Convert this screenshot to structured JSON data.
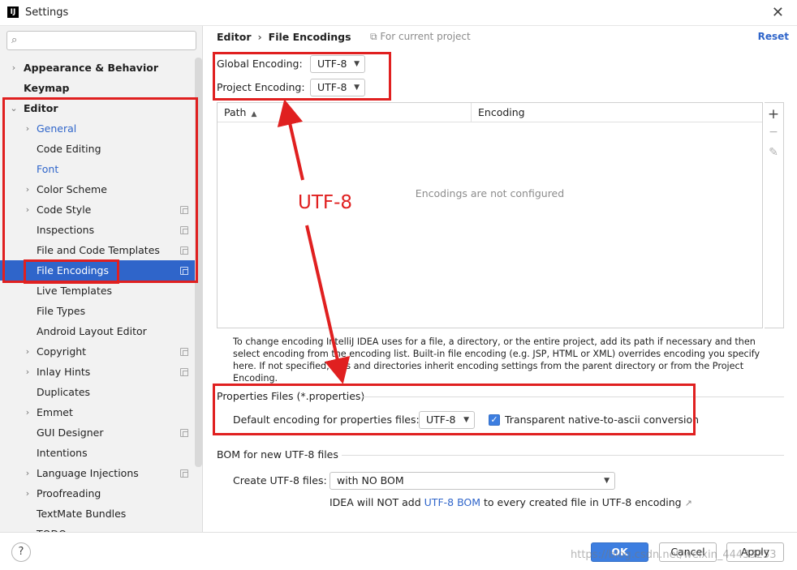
{
  "window": {
    "title": "Settings",
    "app_icon": "IJ"
  },
  "search": {
    "placeholder": ""
  },
  "sidebar": {
    "items": [
      {
        "label": "Appearance & Behavior",
        "level": 0,
        "arrow": "›",
        "marker": false
      },
      {
        "label": "Keymap",
        "level": 0,
        "arrow": "",
        "marker": false
      },
      {
        "label": "Editor",
        "level": 0,
        "arrow": "⌄",
        "marker": false
      },
      {
        "label": "General",
        "level": 1,
        "arrow": "›",
        "marker": false,
        "blue": true
      },
      {
        "label": "Code Editing",
        "level": 1,
        "arrow": "",
        "marker": false
      },
      {
        "label": "Font",
        "level": 1,
        "arrow": "",
        "marker": false,
        "blue": true
      },
      {
        "label": "Color Scheme",
        "level": 1,
        "arrow": "›",
        "marker": false
      },
      {
        "label": "Code Style",
        "level": 1,
        "arrow": "›",
        "marker": true
      },
      {
        "label": "Inspections",
        "level": 1,
        "arrow": "",
        "marker": true
      },
      {
        "label": "File and Code Templates",
        "level": 1,
        "arrow": "",
        "marker": true
      },
      {
        "label": "File Encodings",
        "level": 1,
        "arrow": "",
        "marker": true,
        "selected": true
      },
      {
        "label": "Live Templates",
        "level": 1,
        "arrow": "",
        "marker": false
      },
      {
        "label": "File Types",
        "level": 1,
        "arrow": "",
        "marker": false
      },
      {
        "label": "Android Layout Editor",
        "level": 1,
        "arrow": "",
        "marker": false
      },
      {
        "label": "Copyright",
        "level": 1,
        "arrow": "›",
        "marker": true
      },
      {
        "label": "Inlay Hints",
        "level": 1,
        "arrow": "›",
        "marker": true
      },
      {
        "label": "Duplicates",
        "level": 1,
        "arrow": "",
        "marker": false
      },
      {
        "label": "Emmet",
        "level": 1,
        "arrow": "›",
        "marker": false
      },
      {
        "label": "GUI Designer",
        "level": 1,
        "arrow": "",
        "marker": true
      },
      {
        "label": "Intentions",
        "level": 1,
        "arrow": "",
        "marker": false
      },
      {
        "label": "Language Injections",
        "level": 1,
        "arrow": "›",
        "marker": true
      },
      {
        "label": "Proofreading",
        "level": 1,
        "arrow": "›",
        "marker": false
      },
      {
        "label": "TextMate Bundles",
        "level": 1,
        "arrow": "",
        "marker": false
      },
      {
        "label": "TODO",
        "level": 1,
        "arrow": "",
        "marker": false
      }
    ]
  },
  "header": {
    "crumb_parent": "Editor",
    "crumb_sep": "›",
    "crumb_current": "File Encodings",
    "scope_icon": "⧉",
    "scope_label": "For current project",
    "reset_label": "Reset"
  },
  "encoding": {
    "global_label": "Global Encoding:",
    "global_value": "UTF-8",
    "project_label": "Project Encoding:",
    "project_value": "UTF-8"
  },
  "table": {
    "col_path": "Path",
    "col_encoding": "Encoding",
    "empty_message": "Encodings are not configured",
    "tool_add": "+",
    "tool_remove": "−",
    "tool_edit": "✎"
  },
  "help_text": "To change encoding IntelliJ IDEA uses for a file, a directory, or the entire project, add its path if necessary and then select encoding from the encoding list. Built-in file encoding (e.g. JSP, HTML or XML) overrides encoding you specify here. If not specified, files and directories inherit encoding settings from the parent directory or from the Project Encoding.",
  "properties": {
    "section_title": "Properties Files (*.properties)",
    "default_label": "Default encoding for properties files:",
    "default_value": "UTF-8",
    "native_checkbox_checked": true,
    "native_label": "Transparent native-to-ascii conversion"
  },
  "bom": {
    "section_title": "BOM for new UTF-8 files",
    "create_label": "Create UTF-8 files:",
    "create_value": "with NO BOM",
    "note_prefix": "IDEA will NOT add ",
    "note_link": "UTF-8 BOM",
    "note_suffix": " to every created file in UTF-8 encoding",
    "note_icon": "↗"
  },
  "annotation": {
    "text": "UTF-8",
    "color": "#e02020"
  },
  "footer": {
    "help_label": "?",
    "ok_label": "OK",
    "cancel_label": "Cancel",
    "apply_label": "Apply",
    "watermark": "https://blog.csdn.net/weixin_44433253"
  },
  "colors": {
    "accent": "#2f65ca",
    "selection": "#2f65ca",
    "checkbox": "#3d7ee0",
    "annotation_red": "#e02020"
  }
}
